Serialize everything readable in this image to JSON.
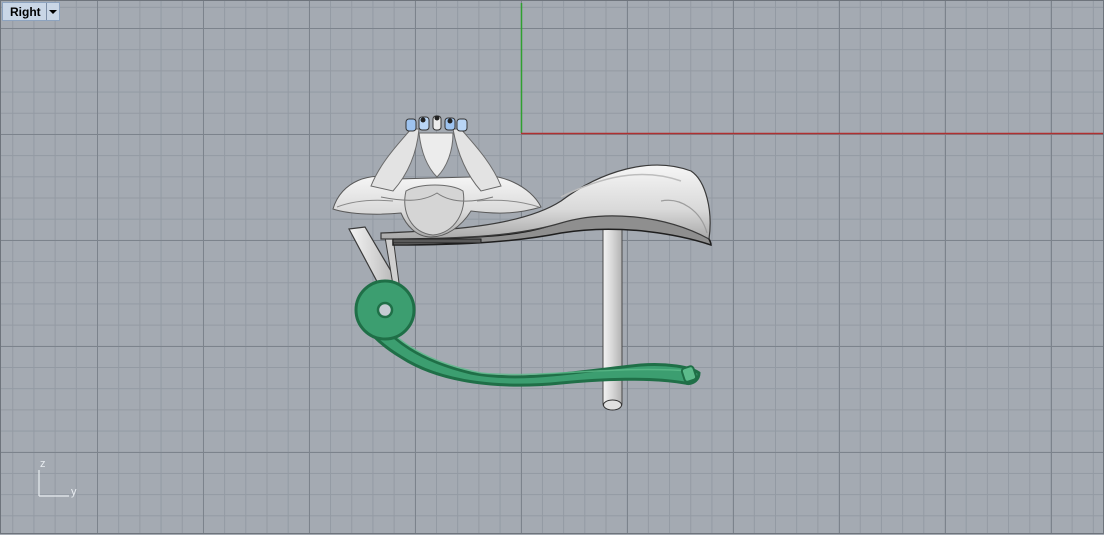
{
  "viewport": {
    "name": "Right"
  },
  "axis_widget": {
    "vertical": "z",
    "horizontal": "y"
  },
  "colors": {
    "background": "#a4aab2",
    "major_grid": "#7c838c",
    "minor_grid": "#939aa3",
    "x_axis": "#b03030",
    "y_axis": "#30a030",
    "selected_part": "#2e9a66",
    "part_gray": "#e6e6e6"
  },
  "icons": [
    "dropdown-arrow-icon"
  ]
}
